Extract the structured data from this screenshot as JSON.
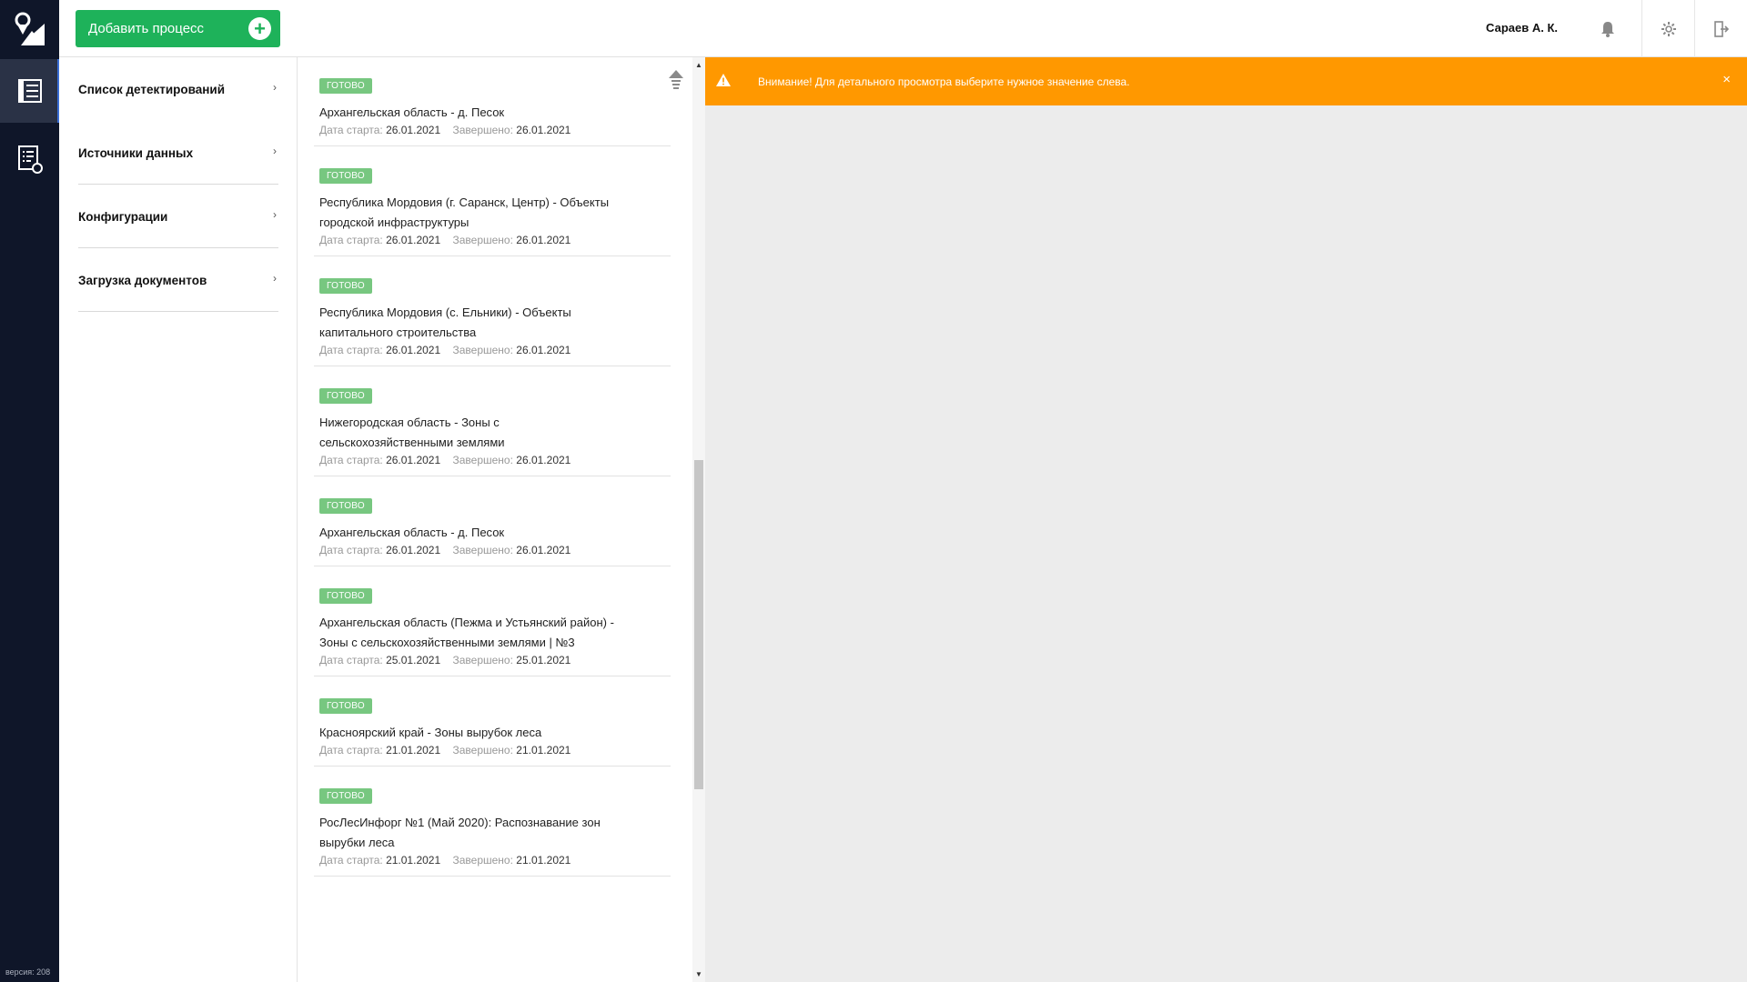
{
  "app": {
    "version_label": "версия: 208"
  },
  "header": {
    "add_process_label": "Добавить процесс",
    "user_name": "Сараев А. К."
  },
  "menu": {
    "items": [
      {
        "label": "Список детектирований"
      },
      {
        "label": "Источники данных"
      },
      {
        "label": "Конфигурации"
      },
      {
        "label": "Загрузка документов"
      }
    ]
  },
  "list": {
    "start_label": "Дата старта:",
    "end_label": "Завершено:",
    "items": [
      {
        "status": "ГОТОВО",
        "title": "Архангельская область - д. Песок",
        "start": "26.01.2021",
        "end": "26.01.2021"
      },
      {
        "status": "ГОТОВО",
        "title": "Республика Мордовия (г. Саранск, Центр) - Объекты городской инфраструктуры",
        "start": "26.01.2021",
        "end": "26.01.2021"
      },
      {
        "status": "ГОТОВО",
        "title": "Республика Мордовия (с. Ельники) - Объекты капитального строительства",
        "start": "26.01.2021",
        "end": "26.01.2021"
      },
      {
        "status": "ГОТОВО",
        "title": "Нижегородская область - Зоны с сельскохозяйственными землями",
        "start": "26.01.2021",
        "end": "26.01.2021"
      },
      {
        "status": "ГОТОВО",
        "title": "Архангельская область - д. Песок",
        "start": "26.01.2021",
        "end": "26.01.2021"
      },
      {
        "status": "ГОТОВО",
        "title": "Архангельская область (Пежма и Устьянский район) - Зоны с сельскохозяйственными землями | №3",
        "start": "25.01.2021",
        "end": "25.01.2021"
      },
      {
        "status": "ГОТОВО",
        "title": "Красноярский край - Зоны вырубок леса",
        "start": "21.01.2021",
        "end": "21.01.2021"
      },
      {
        "status": "ГОТОВО",
        "title": "РосЛесИнфорг №1 (Май 2020): Распознавание зон вырубки леса",
        "start": "21.01.2021",
        "end": "21.01.2021"
      }
    ]
  },
  "alert": {
    "message": "Внимание! Для детального просмотра выберите нужное значение слева.",
    "close": "×",
    "color": "#ff9800"
  },
  "colors": {
    "accent_green": "#1eb25a",
    "badge_green": "#77c780",
    "rail": "#0f1629"
  }
}
